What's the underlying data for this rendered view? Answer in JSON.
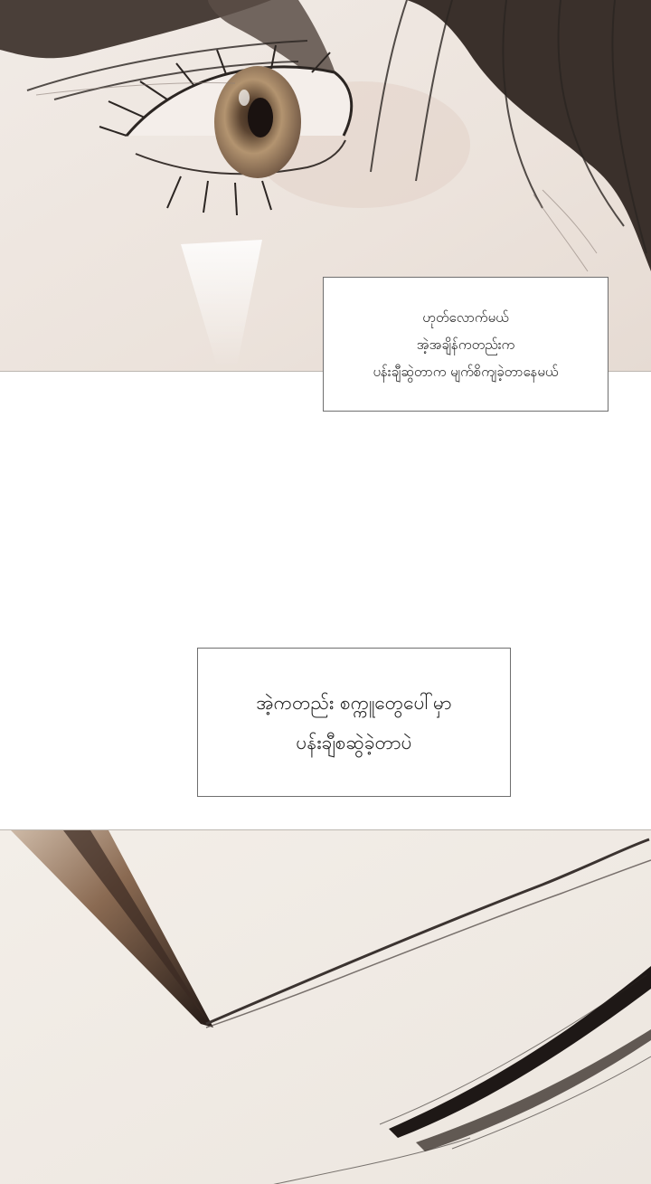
{
  "colors": {
    "paper": "#efe9e3",
    "ink": "#2b2522",
    "iris": "#9a7b58",
    "caption_border": "#6f6f6f"
  },
  "panels": {
    "top": {
      "subject": "close-up of eye with dark hair"
    },
    "bottom": {
      "subject": "ink brush stroke"
    }
  },
  "captions": [
    {
      "lines": [
        "ဟုတ်လောက်မယ်",
        "အဲ့အချိန်ကတည်းက",
        "ပန်းချီဆွဲတာက မျက်စိကျခဲ့တာနေမယ်"
      ]
    },
    {
      "lines": [
        "အဲ့ကတည်း စက္ကူတွေပေါ်မှာ",
        "ပန်းချီစဆွဲခဲ့တာပဲ"
      ]
    }
  ]
}
